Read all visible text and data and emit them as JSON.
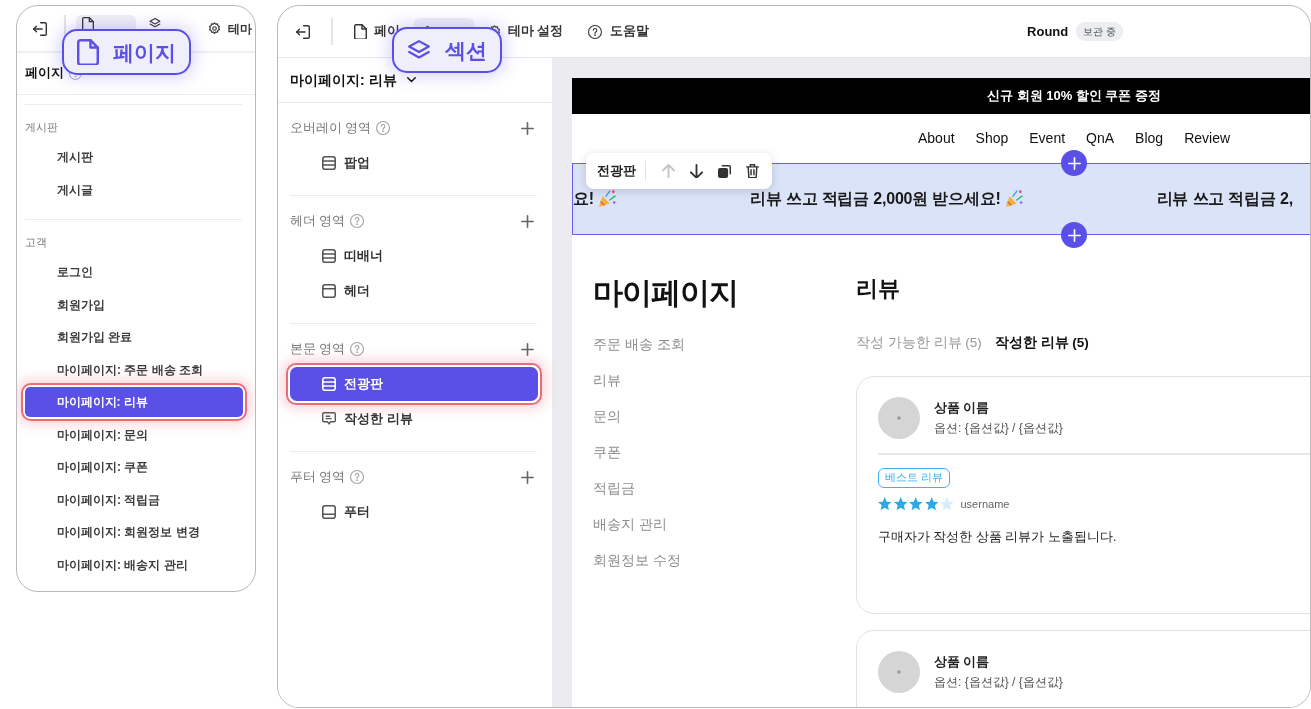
{
  "left_window": {
    "toolbar": {
      "tabs": [
        {
          "kind": "page",
          "selected": true
        },
        {
          "kind": "layers",
          "selected": false
        },
        {
          "kind": "gear",
          "label": "테마",
          "selected": false
        }
      ]
    },
    "callout": {
      "kind": "page",
      "label": "페이지"
    },
    "panel_title": "페이지",
    "groups": [
      {
        "label": "게시판",
        "items": [
          {
            "label": "게시판",
            "selected": false
          },
          {
            "label": "게시글",
            "selected": false
          }
        ]
      },
      {
        "label": "고객",
        "items": [
          {
            "label": "로그인",
            "selected": false
          },
          {
            "label": "회원가입",
            "selected": false
          },
          {
            "label": "회원가입 완료",
            "selected": false
          },
          {
            "label": "마이페이지: 주문 배송 조회",
            "selected": false
          },
          {
            "label": "마이페이지: 리뷰",
            "selected": true
          },
          {
            "label": "마이페이지: 문의",
            "selected": false
          },
          {
            "label": "마이페이지: 쿠폰",
            "selected": false
          },
          {
            "label": "마이페이지: 적립금",
            "selected": false
          },
          {
            "label": "마이페이지: 회원정보 변경",
            "selected": false
          },
          {
            "label": "마이페이지: 배송지 관리",
            "selected": false
          }
        ]
      }
    ]
  },
  "right_window": {
    "toolbar": {
      "tabs": [
        {
          "kind": "page",
          "label": "페이",
          "selected": false
        },
        {
          "kind": "layers",
          "selected": true
        },
        {
          "kind": "gear",
          "label": "테마 설정",
          "selected": false
        }
      ],
      "help": "도움말",
      "site_name": "Round",
      "status": "보관 중"
    },
    "callout": {
      "kind": "layers",
      "label": "섹션"
    },
    "page_select": "마이페이지: 리뷰",
    "groups": [
      {
        "label": "오버레이 영역",
        "items": [
          {
            "kind": "bands",
            "label": "팝업",
            "selected": false
          }
        ]
      },
      {
        "label": "헤더 영역",
        "items": [
          {
            "kind": "bands",
            "label": "띠배너",
            "selected": false
          },
          {
            "kind": "top-band",
            "label": "헤더",
            "selected": false
          }
        ]
      },
      {
        "label": "본문 영역",
        "items": [
          {
            "kind": "bands",
            "label": "전광판",
            "selected": true
          },
          {
            "kind": "chat",
            "label": "작성한 리뷰",
            "selected": false
          }
        ]
      },
      {
        "label": "푸터 영역",
        "items": [
          {
            "kind": "bottom-band",
            "label": "푸터",
            "selected": false
          }
        ]
      }
    ],
    "preview": {
      "announcement": "신규 회원 10% 할인 쿠폰 증정",
      "nav": [
        "About",
        "Shop",
        "Event",
        "QnA",
        "Blog",
        "Review"
      ],
      "marquee": {
        "selected": true,
        "items": [
          {
            "kind": "emoji",
            "text": "요!"
          },
          {
            "kind": "emoji",
            "text": "리뷰 쓰고 적립금 2,000원 받으세요!"
          },
          {
            "kind": "plain",
            "text": "리뷰 쓰고 적립금 2,"
          }
        ]
      },
      "section_toolbar": {
        "label": "전광판",
        "actions": [
          {
            "kind": "arrow-up",
            "disabled": true
          },
          {
            "kind": "arrow-down",
            "disabled": false
          },
          {
            "kind": "copy",
            "disabled": false
          },
          {
            "kind": "trash",
            "disabled": false
          }
        ]
      },
      "sidebar": {
        "title": "마이페이지",
        "items": [
          "주문 배송 조회",
          "리뷰",
          "문의",
          "쿠폰",
          "적립금",
          "배송지 관리",
          "회원정보 수정"
        ]
      },
      "content": {
        "title": "리뷰",
        "tabs": [
          {
            "label": "작성 가능한 리뷰 (5)",
            "selected": false
          },
          {
            "label": "작성한 리뷰 (5)",
            "selected": true
          }
        ],
        "reviews": [
          {
            "product": "상품 이름",
            "option": "옵션: {옵션값} / {옵션값}",
            "badge": "베스트 리뷰",
            "stars": 4,
            "author": "username",
            "body": "구매자가 작성한 상품 리뷰가 노출됩니다."
          },
          {
            "product": "상품 이름",
            "option": "옵션: {옵션값} / {옵션값}"
          }
        ]
      }
    }
  }
}
